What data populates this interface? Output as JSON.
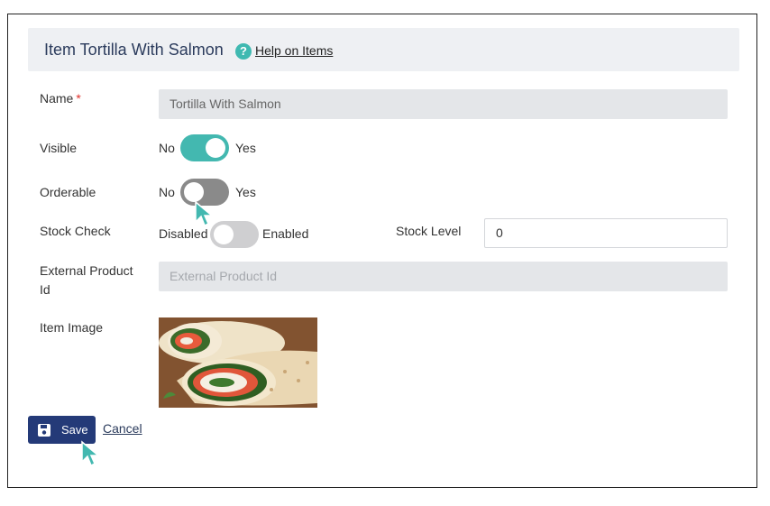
{
  "header": {
    "title": "Item Tortilla With Salmon",
    "help_link": "Help on Items",
    "help_icon": "question-circle-icon"
  },
  "form": {
    "name": {
      "label": "Name",
      "required_mark": "*",
      "value": "Tortilla With Salmon"
    },
    "visible": {
      "label": "Visible",
      "off_text": "No",
      "on_text": "Yes",
      "state": "on"
    },
    "orderable": {
      "label": "Orderable",
      "off_text": "No",
      "on_text": "Yes",
      "state": "off"
    },
    "stock_check": {
      "label": "Stock Check",
      "off_text": "Disabled",
      "on_text": "Enabled",
      "state": "off"
    },
    "stock_level": {
      "label": "Stock Level",
      "value": "0"
    },
    "external_product_id": {
      "label_line1": "External Product",
      "label_line2": "Id",
      "placeholder": "External Product Id"
    },
    "item_image": {
      "label": "Item Image"
    }
  },
  "actions": {
    "save_label": "Save",
    "save_icon": "floppy-disk-icon",
    "cancel_label": "Cancel"
  },
  "colors": {
    "accent_teal": "#43b8b0",
    "primary_navy": "#243a78",
    "title_color": "#2b3b5c",
    "required_red": "#e0312c",
    "header_bg": "#eef0f3",
    "disabled_field_bg": "#e4e6e9"
  }
}
